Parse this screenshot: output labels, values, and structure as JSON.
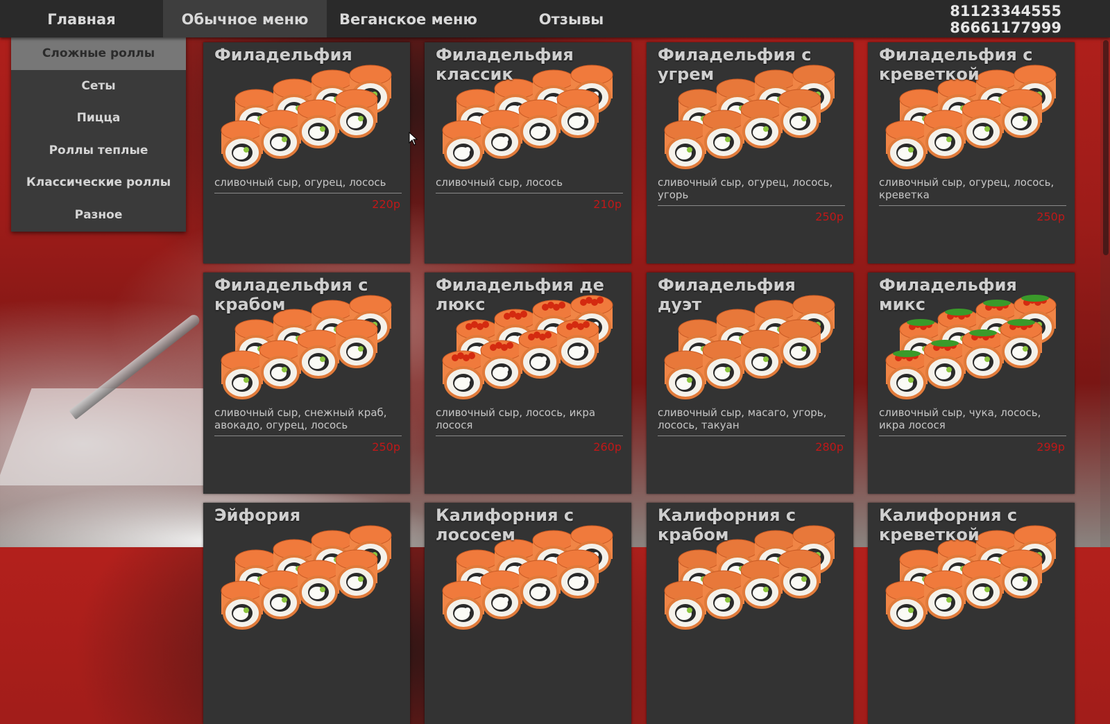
{
  "nav": {
    "items": [
      {
        "label": "Главная"
      },
      {
        "label": "Обычное меню"
      },
      {
        "label": "Веганское меню"
      },
      {
        "label": "Отзывы"
      }
    ],
    "phones": [
      "81123344555",
      "86661177999"
    ]
  },
  "submenu": {
    "items": [
      {
        "label": "Сложные роллы"
      },
      {
        "label": "Сеты"
      },
      {
        "label": "Пицца"
      },
      {
        "label": "Роллы теплые"
      },
      {
        "label": "Классические роллы"
      },
      {
        "label": "Разное"
      }
    ]
  },
  "products": [
    {
      "title": "Филадельфия",
      "desc": "сливочный сыр, огурец, лосось",
      "price": "220р"
    },
    {
      "title": "Филадельфия классик",
      "desc": "сливочный сыр, лосось",
      "price": "210р"
    },
    {
      "title": "Филадельфия с угрем",
      "desc": "сливочный сыр, огурец, лосось, угорь",
      "price": "250р"
    },
    {
      "title": "Филадельфия с креветкой",
      "desc": "сливочный сыр, огурец, лосось, креветка",
      "price": "250р"
    },
    {
      "title": "Филадельфия с крабом",
      "desc": "сливочный сыр, снежный краб, авокадо, огурец, лосось",
      "price": "250р"
    },
    {
      "title": "Филадельфия де люкс",
      "desc": "сливочный сыр, лосось, икра лосося",
      "price": "260р"
    },
    {
      "title": "Филадельфия дуэт",
      "desc": "сливочный сыр, масаго, угорь, лосось, такуан",
      "price": "280р"
    },
    {
      "title": "Филадельфия микс",
      "desc": "сливочный сыр, чука, лосось, икра лосося",
      "price": "299р"
    },
    {
      "title": "Эйфория"
    },
    {
      "title": "Калифорния с лососем"
    },
    {
      "title": "Калифорния с крабом"
    },
    {
      "title": "Калифорния с креветкой"
    }
  ],
  "colors": {
    "topbar": "#2a2a2a",
    "card": "#333333",
    "price": "#c01818",
    "submenu_active": "#777777"
  }
}
